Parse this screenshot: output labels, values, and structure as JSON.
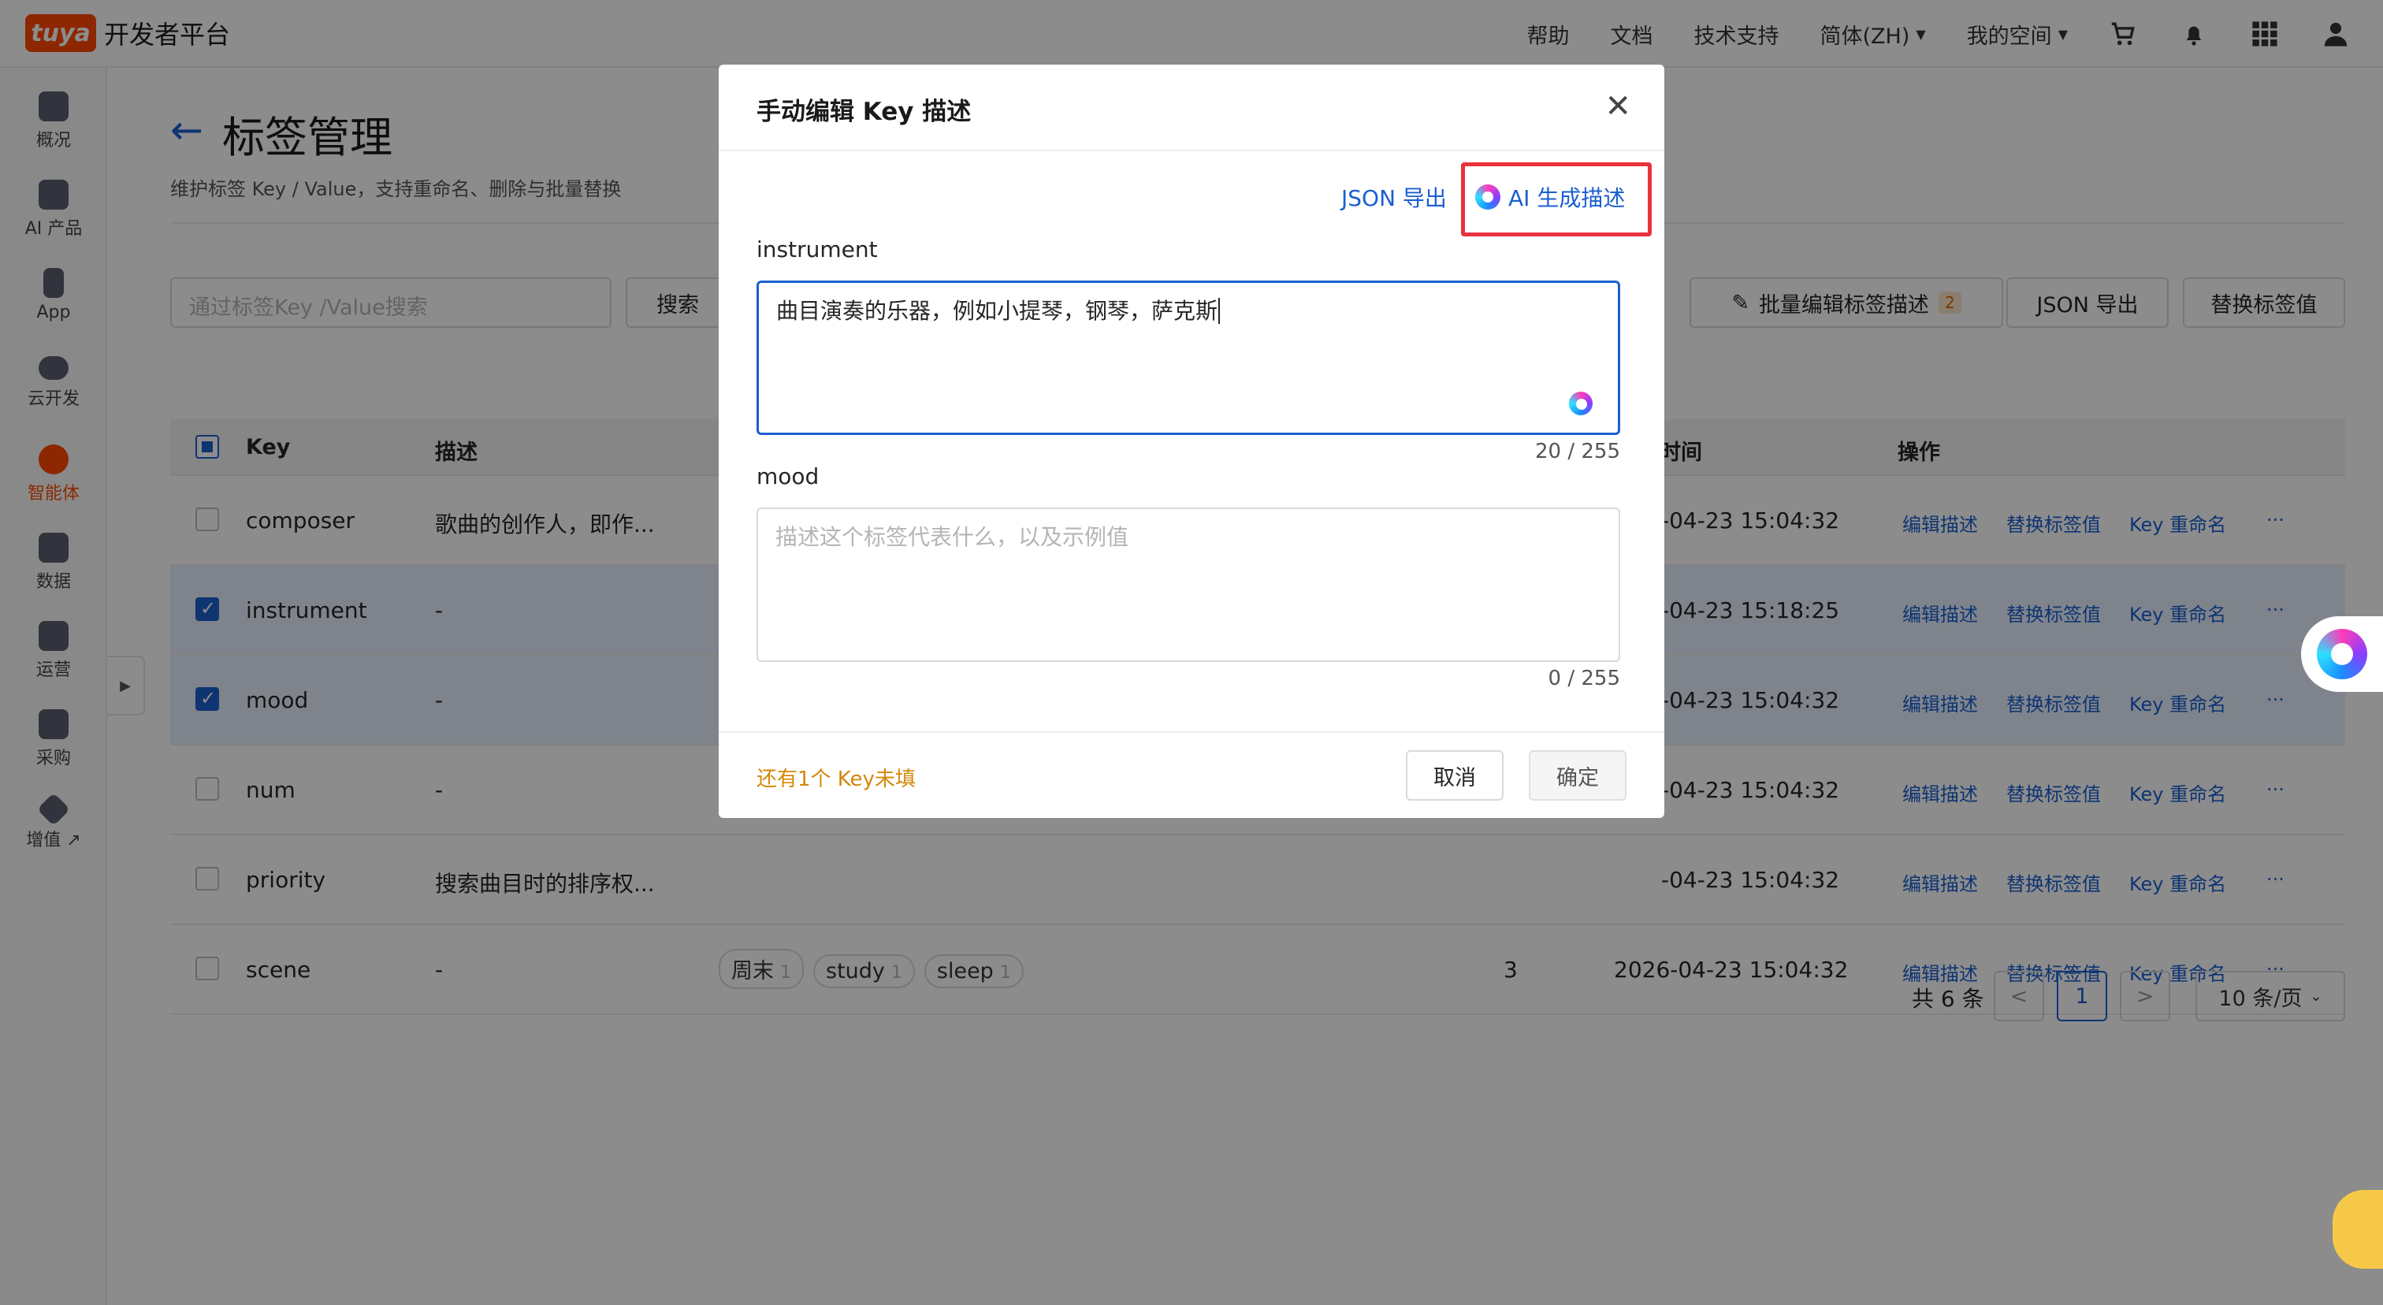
{
  "topbar": {
    "logo": "tuya",
    "platform": "开发者平台",
    "nav": [
      "帮助",
      "文档",
      "技术支持",
      "简体(ZH)",
      "我的空间"
    ],
    "icons": [
      "cart-icon",
      "bell-icon",
      "apps-grid-icon",
      "user-icon"
    ]
  },
  "leftnav": {
    "items": [
      {
        "label": "概况",
        "icon": "home-icon"
      },
      {
        "label": "AI 产品",
        "icon": "terminal-icon"
      },
      {
        "label": "App",
        "icon": "phone-icon"
      },
      {
        "label": "云开发",
        "icon": "cloud-icon"
      },
      {
        "label": "智能体",
        "icon": "agent-icon",
        "active": true
      },
      {
        "label": "数据",
        "icon": "chart-icon"
      },
      {
        "label": "运营",
        "icon": "star-icon"
      },
      {
        "label": "采购",
        "icon": "box-icon"
      },
      {
        "label": "增值 ↗",
        "icon": "diamond-icon"
      }
    ]
  },
  "page": {
    "title": "标签管理",
    "subtitle": "维护标签 Key / Value，支持重命名、删除与批量替换",
    "search_placeholder": "通过标签Key /Value搜索",
    "search_button": "搜索",
    "batch_edit": "批量编辑标签描述",
    "batch_count": "2",
    "json_export": "JSON 导出",
    "replace_values": "替换标签值"
  },
  "table": {
    "headers": {
      "key": "Key",
      "desc": "描述",
      "time": "时间",
      "ops": "操作"
    },
    "rows": [
      {
        "key": "composer",
        "desc": "歌曲的创作人，即作...",
        "time": "-04-23 15:04:32",
        "checked": false
      },
      {
        "key": "instrument",
        "desc": "-",
        "time": "-04-23 15:18:25",
        "checked": true
      },
      {
        "key": "mood",
        "desc": "-",
        "time": "-04-23 15:04:32",
        "checked": true
      },
      {
        "key": "num",
        "desc": "-",
        "time": "-04-23 15:04:32",
        "checked": false
      },
      {
        "key": "priority",
        "desc": "搜索曲目时的排序权...",
        "time": "-04-23 15:04:32",
        "checked": false
      },
      {
        "key": "scene",
        "desc": "-",
        "time": "2026-04-23 15:04:32",
        "count": "3",
        "checked": false,
        "tags": [
          {
            "name": "周末",
            "n": "1"
          },
          {
            "name": "study",
            "n": "1"
          },
          {
            "name": "sleep",
            "n": "1"
          }
        ]
      }
    ],
    "actions": [
      "编辑描述",
      "替换标签值",
      "Key 重命名",
      "···"
    ]
  },
  "pagination": {
    "total": "共 6 条",
    "prev": "<",
    "current": "1",
    "next": ">",
    "page_size": "10 条/页"
  },
  "modal": {
    "title": "手动编辑 Key 描述",
    "json_export": "JSON 导出",
    "ai_generate": "AI 生成描述",
    "fields": [
      {
        "label": "instrument",
        "value": "曲目演奏的乐器，例如小提琴，钢琴，萨克斯",
        "counter": "20 / 255"
      },
      {
        "label": "mood",
        "placeholder": "描述这个标签代表什么，以及示例值",
        "counter": "0 / 255"
      }
    ],
    "warning": "还有1个 Key未填",
    "cancel": "取消",
    "confirm": "确定"
  },
  "colors": {
    "accent": "#1a5fd0",
    "brand": "#ff4800",
    "highlight": "#e8323c",
    "warning": "#d48806"
  }
}
